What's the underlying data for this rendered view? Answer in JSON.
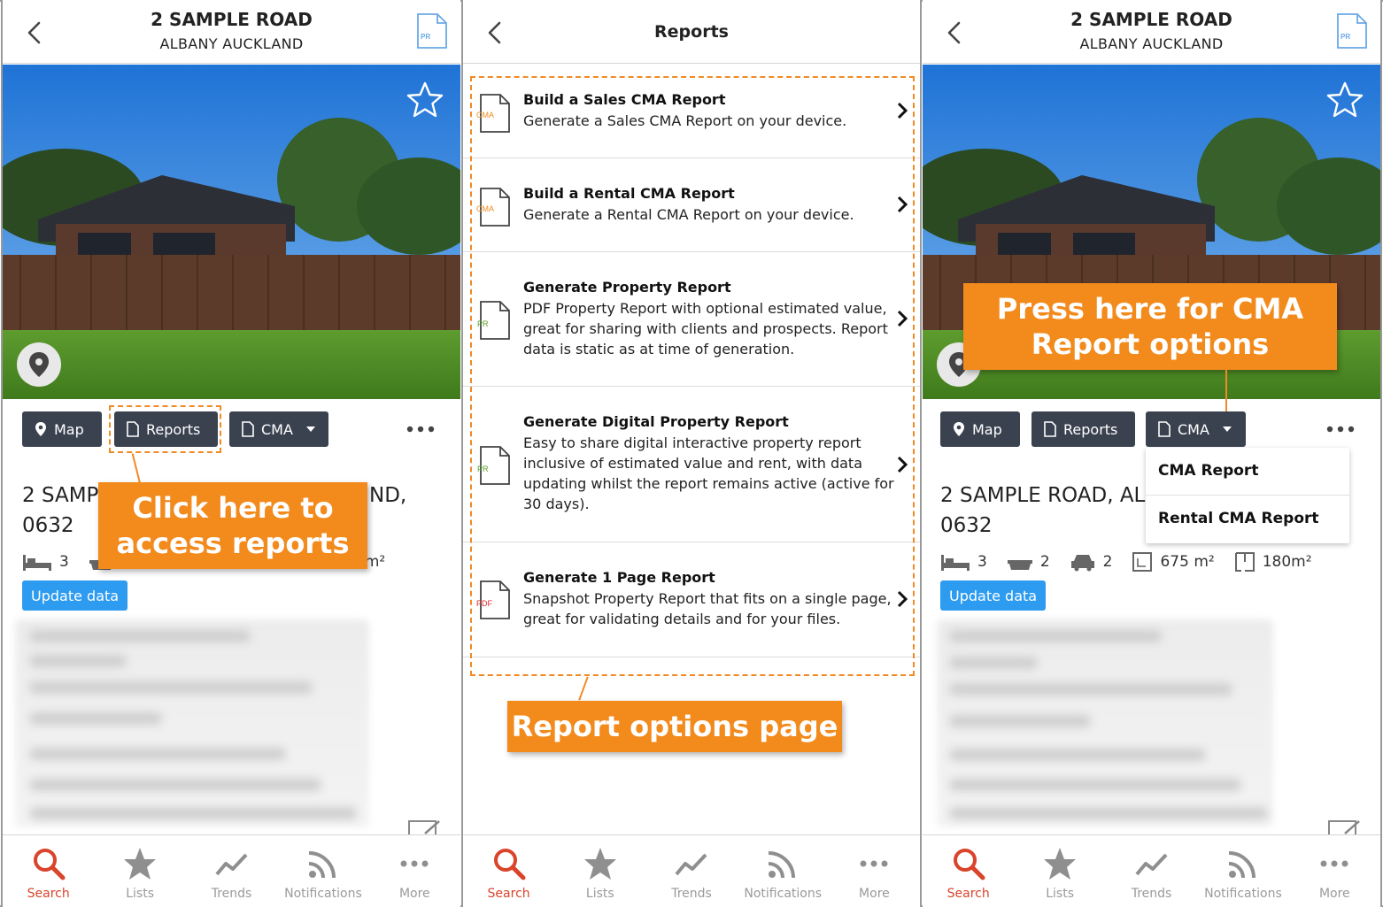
{
  "property": {
    "title": "2 SAMPLE ROAD",
    "subtitle": "ALBANY AUCKLAND",
    "address_line1_p1": "2 SAMP",
    "address_line1_p1_tail": "ND,",
    "address_line1_p3": "2 SAMPLE ROAD, ALE",
    "address_line2": "0632",
    "bedrooms": "3",
    "bathrooms": "2",
    "carparks": "2",
    "land_area": "675 m²",
    "floor_area": "180m²",
    "floor_area_p1": "0m²",
    "update_label": "Update data"
  },
  "actions": {
    "map_label": "Map",
    "reports_label": "Reports",
    "cma_label": "CMA"
  },
  "reports_page": {
    "title": "Reports",
    "items": [
      {
        "icon_tag": "CMA",
        "title": "Build a Sales CMA Report",
        "desc": "Generate a Sales CMA Report on your device."
      },
      {
        "icon_tag": "CMA",
        "title": "Build a Rental CMA Report",
        "desc": "Generate a Rental CMA Report on your device."
      },
      {
        "icon_tag": "PR",
        "title": "Generate Property Report",
        "desc": "PDF Property Report with optional estimated value, great for sharing with clients and prospects. Report data is static as at time of generation."
      },
      {
        "icon_tag": "PR",
        "title": "Generate Digital Property Report",
        "desc": "Easy to share digital interactive property report inclusive of estimated value and rent, with data updating whilst the report remains active (active for 30 days)."
      },
      {
        "icon_tag": "PDF",
        "title": "Generate 1 Page Report",
        "desc": "Snapshot Property Report that fits on a single page, great for validating details and for your files."
      }
    ]
  },
  "cma_menu": {
    "item1": "CMA Report",
    "item2": "Rental CMA Report"
  },
  "header_icon_tag": "PR",
  "callouts": {
    "reports": "Click here to access reports",
    "options_page": "Report options page",
    "cma": "Press here for CMA Report options"
  },
  "tabbar": [
    {
      "label": "Search",
      "icon": "search-icon"
    },
    {
      "label": "Lists",
      "icon": "star-icon"
    },
    {
      "label": "Trends",
      "icon": "trends-icon"
    },
    {
      "label": "Notifications",
      "icon": "rss-icon"
    },
    {
      "label": "More",
      "icon": "more-icon"
    }
  ],
  "colors": {
    "accent_orange": "#f28a1c",
    "active_tab": "#d9442b",
    "button_dark": "#3a4250",
    "update_blue": "#2d9bf0"
  }
}
